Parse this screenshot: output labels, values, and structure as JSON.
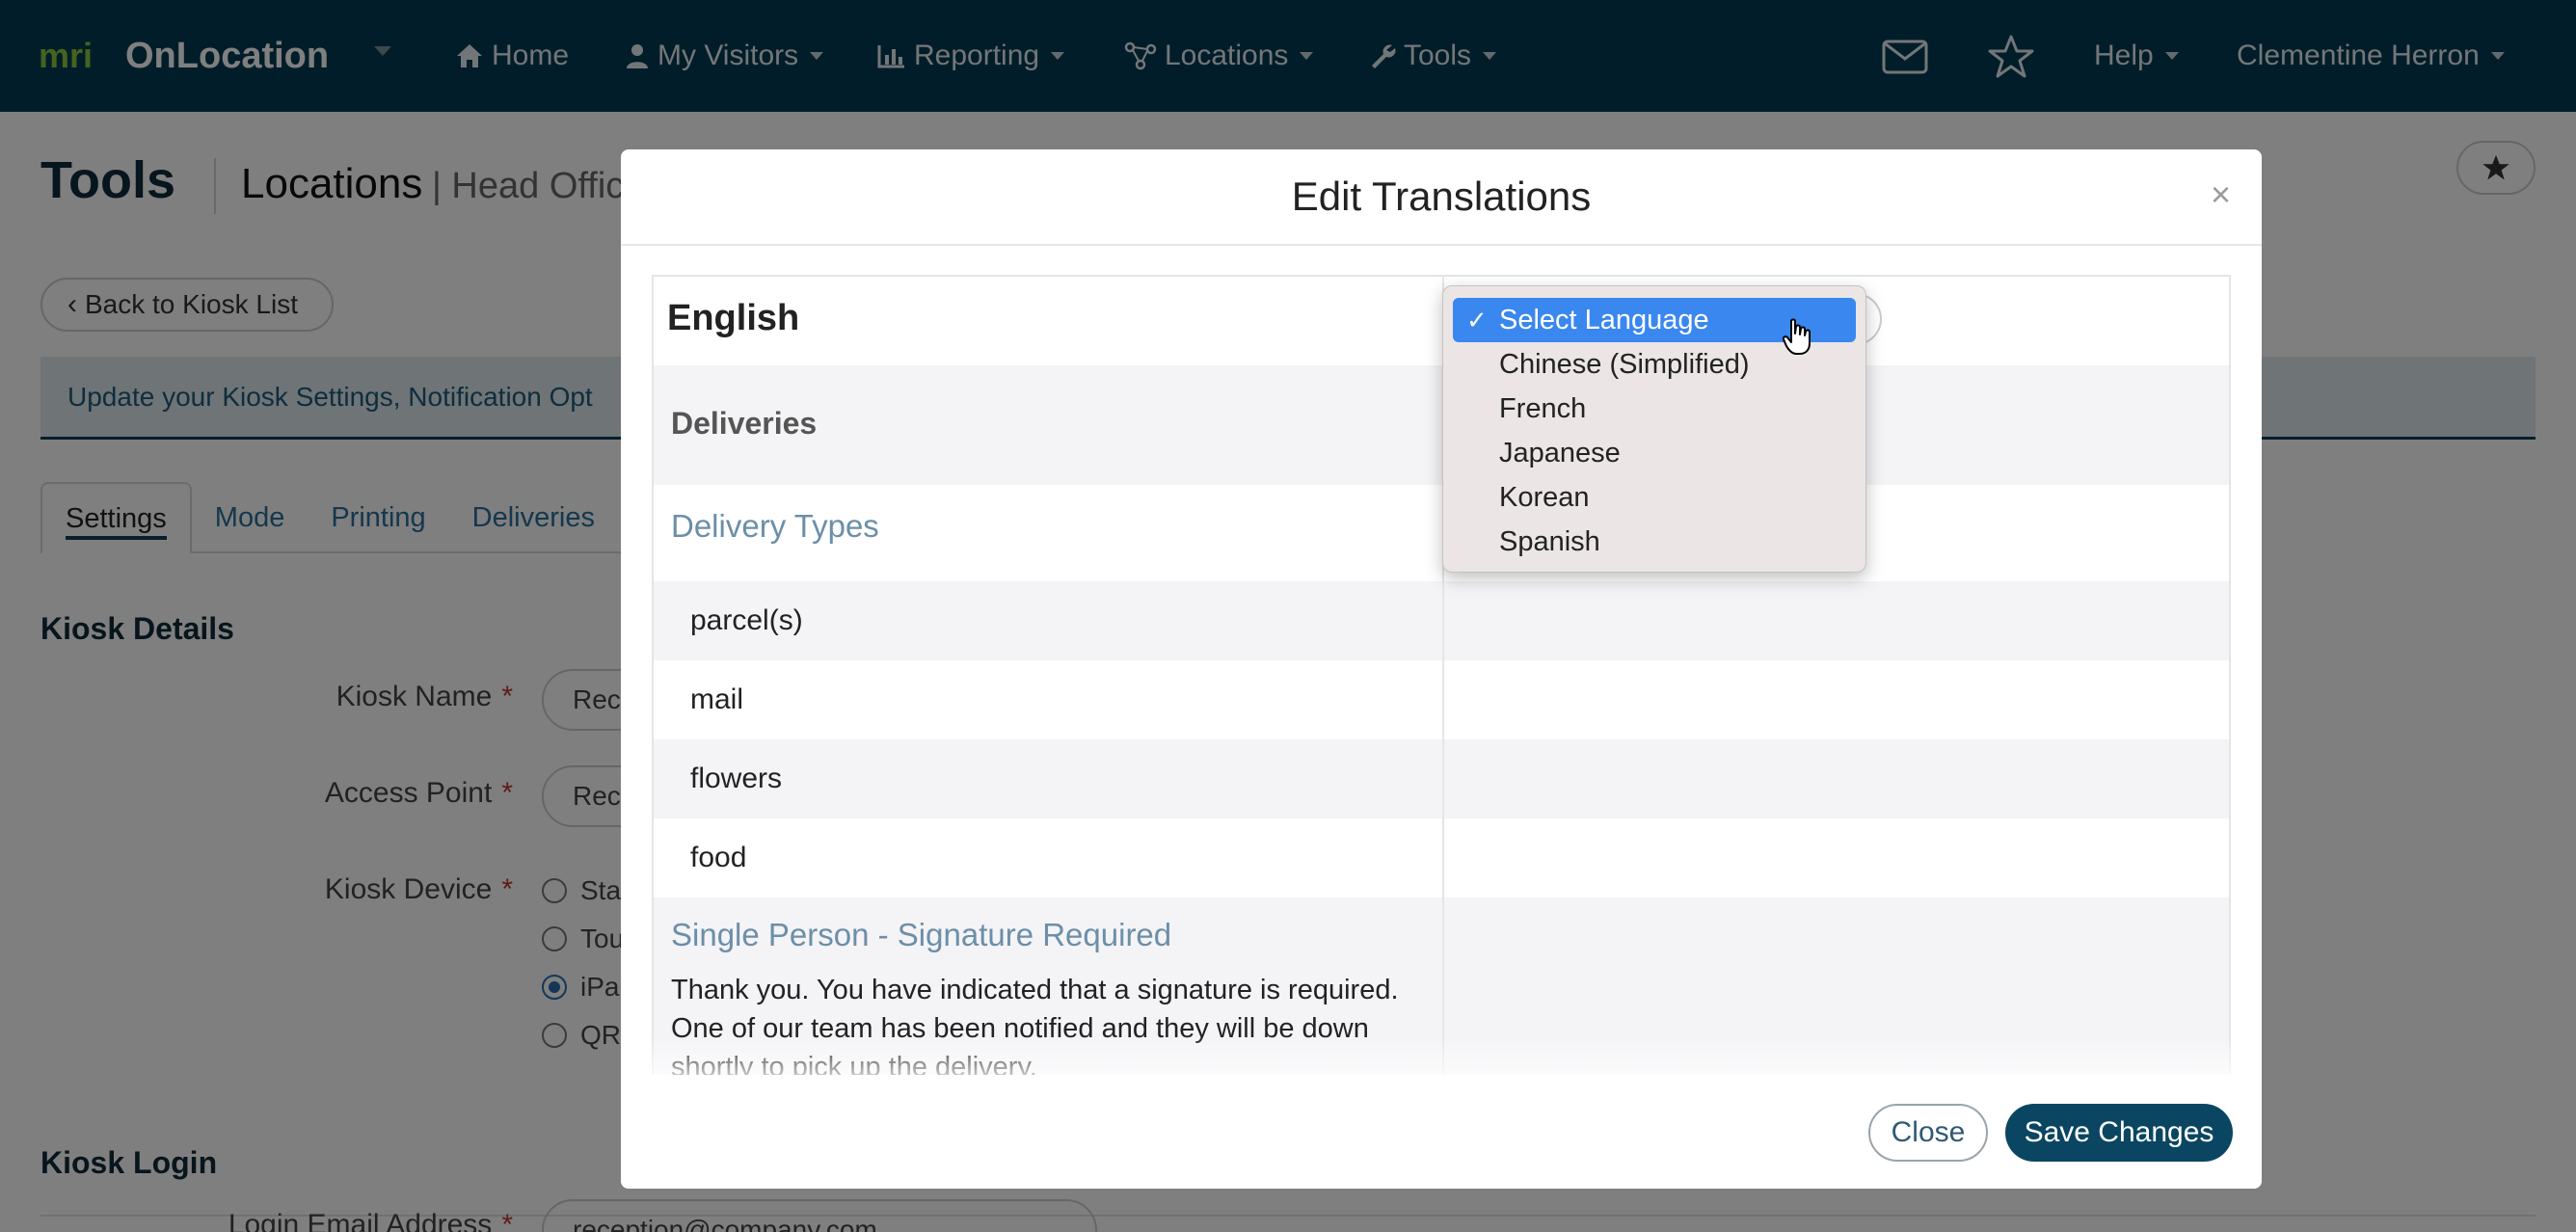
{
  "navbar": {
    "brand_mark": "mri",
    "brand": "OnLocation",
    "items": [
      "Home",
      "My Visitors",
      "Reporting",
      "Locations",
      "Tools"
    ],
    "help": "Help",
    "user": "Clementine Herron"
  },
  "page": {
    "title": "Tools",
    "subtitle": "Locations",
    "subtitle_extra": "| Head Offic",
    "back_label": "Back to Kiosk List",
    "info_text": "Update your Kiosk Settings, Notification Opt",
    "tabs": [
      "Settings",
      "Mode",
      "Printing",
      "Deliveries"
    ],
    "kiosk_details": "Kiosk Details",
    "kiosk_name_label": "Kiosk Name",
    "kiosk_name_value": "Rec",
    "access_point_label": "Access Point",
    "access_point_value": "Rec",
    "kiosk_device_label": "Kiosk Device",
    "device_options": [
      "Sta",
      "Tou",
      "iPa",
      "QR"
    ],
    "kiosk_login": "Kiosk Login",
    "login_email_label": "Login Email Address",
    "login_email_value": "reception@company.com",
    "required_mark": "*"
  },
  "modal": {
    "title": "Edit Translations",
    "close_x": "×",
    "language_header": "English",
    "section": "Deliveries",
    "group1": "Delivery Types",
    "types": [
      "parcel(s)",
      "mail",
      "flowers",
      "food"
    ],
    "group2": "Single Person - Signature Required",
    "message": "Thank you. You have indicated that a signature is required. One of our team has been notified and they will be down shortly to pick up the delivery.",
    "close_button": "Close",
    "save_button": "Save Changes"
  },
  "dropdown": {
    "selected": "Select Language",
    "check": "✓",
    "options": [
      "Chinese (Simplified)",
      "French",
      "Japanese",
      "Korean",
      "Spanish"
    ]
  }
}
